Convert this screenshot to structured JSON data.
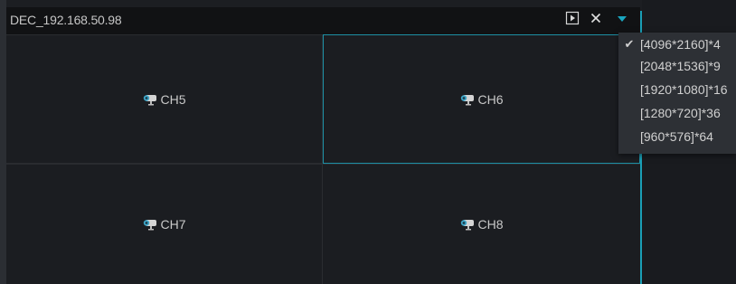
{
  "header": {
    "device_title": "DEC_192.168.50.98",
    "icons": [
      "play-icon",
      "close-icon",
      "dropdown-triangle-icon"
    ]
  },
  "channels": [
    {
      "label": "CH5",
      "icon": "camera-icon",
      "selected": false
    },
    {
      "label": "CH6",
      "icon": "camera-icon",
      "selected": true
    },
    {
      "label": "CH7",
      "icon": "camera-icon",
      "selected": false
    },
    {
      "label": "CH8",
      "icon": "camera-icon",
      "selected": false
    }
  ],
  "resolution_menu": {
    "check_glyph": "✔",
    "items": [
      {
        "label": "[4096*2160]*4",
        "checked": true
      },
      {
        "label": "[2048*1536]*9",
        "checked": false
      },
      {
        "label": "[1920*1080]*16",
        "checked": false
      },
      {
        "label": "[1280*720]*36",
        "checked": false
      },
      {
        "label": "[960*576]*64",
        "checked": false
      }
    ]
  },
  "colors": {
    "accent": "#1a9fb6",
    "header_bg": "#111214",
    "cell_bg": "#1b1d21",
    "menu_bg": "#2d3035"
  }
}
